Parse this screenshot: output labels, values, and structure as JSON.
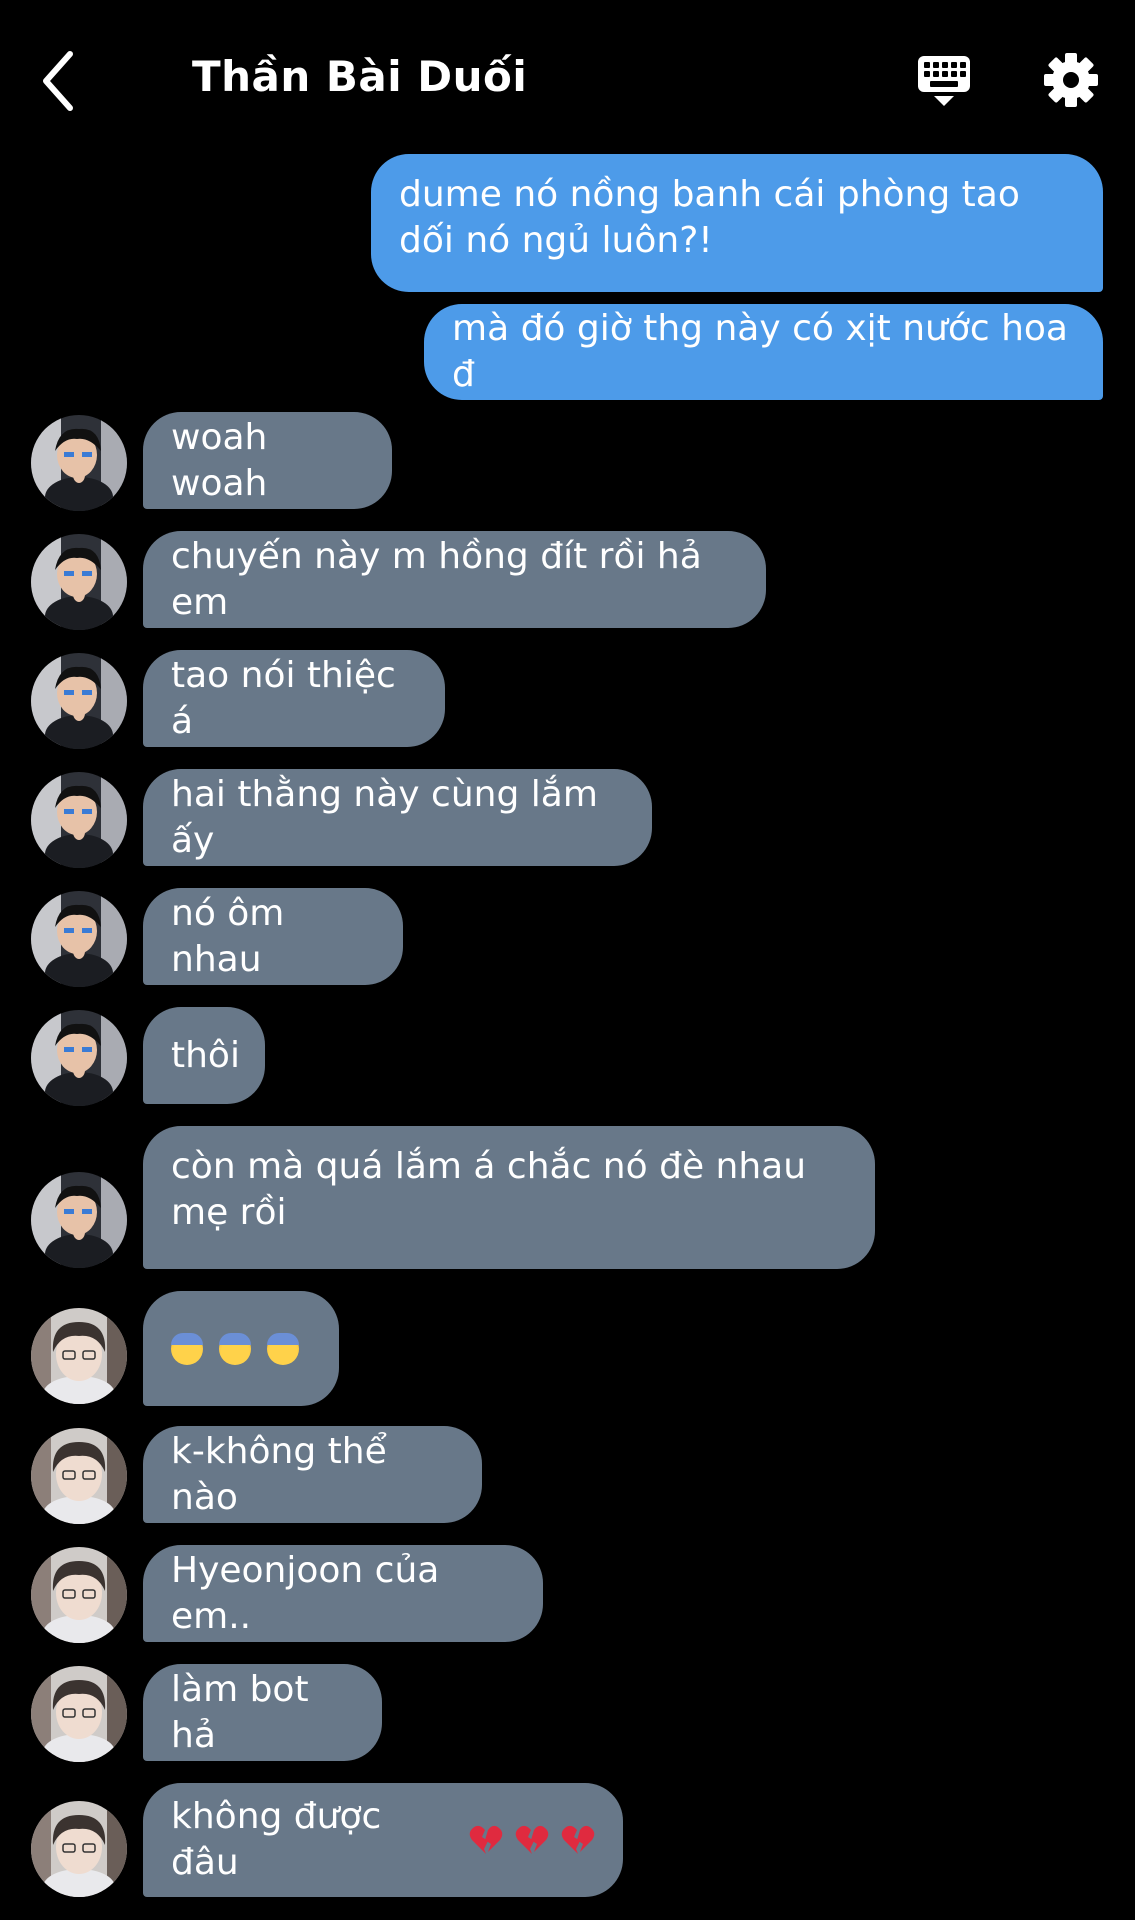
{
  "header": {
    "title": "Thần Bài Duối"
  },
  "colors": {
    "background": "#000000",
    "outgoing_bubble": "#4d9be9",
    "incoming_bubble": "#687889",
    "text": "#ffffff"
  },
  "icons": {
    "back": "chevron-left-icon",
    "keyboard": "keyboard-icon",
    "settings": "gear-icon",
    "emoji_fearful": "fearful-face-emoji",
    "emoji_broken_heart": "broken-heart-emoji"
  },
  "messages": [
    {
      "side": "out",
      "text": "dume nó nồng banh cái phòng tao dối nó ngủ luôn?!"
    },
    {
      "side": "out",
      "text": "mà đó giờ thg này có xịt nước hoa đ"
    },
    {
      "side": "in",
      "avatar": "avatar-a",
      "text": "woah woah"
    },
    {
      "side": "in",
      "avatar": "avatar-a",
      "text": "chuyến này m hồng đít rồi hả em"
    },
    {
      "side": "in",
      "avatar": "avatar-a",
      "text": "tao nói thiệc á"
    },
    {
      "side": "in",
      "avatar": "avatar-a",
      "text": "hai thằng này cùng lắm ấy"
    },
    {
      "side": "in",
      "avatar": "avatar-a",
      "text": "nó ôm nhau"
    },
    {
      "side": "in",
      "avatar": "avatar-a",
      "text": "thôi"
    },
    {
      "side": "in",
      "avatar": "avatar-a",
      "text": "còn mà quá lắm á chắc nó đè nhau mẹ rồi"
    },
    {
      "side": "in",
      "avatar": "avatar-b",
      "emoji": "fearful-face-emoji",
      "emoji_count": 3
    },
    {
      "side": "in",
      "avatar": "avatar-b",
      "text": "k-không thể nào"
    },
    {
      "side": "in",
      "avatar": "avatar-b",
      "text": "Hyeonjoon của em.."
    },
    {
      "side": "in",
      "avatar": "avatar-b",
      "text": "làm bot hả"
    },
    {
      "side": "in",
      "avatar": "avatar-b",
      "text": "không được đâu",
      "trailing_emoji": "broken-heart-emoji",
      "trailing_emoji_count": 3
    }
  ]
}
